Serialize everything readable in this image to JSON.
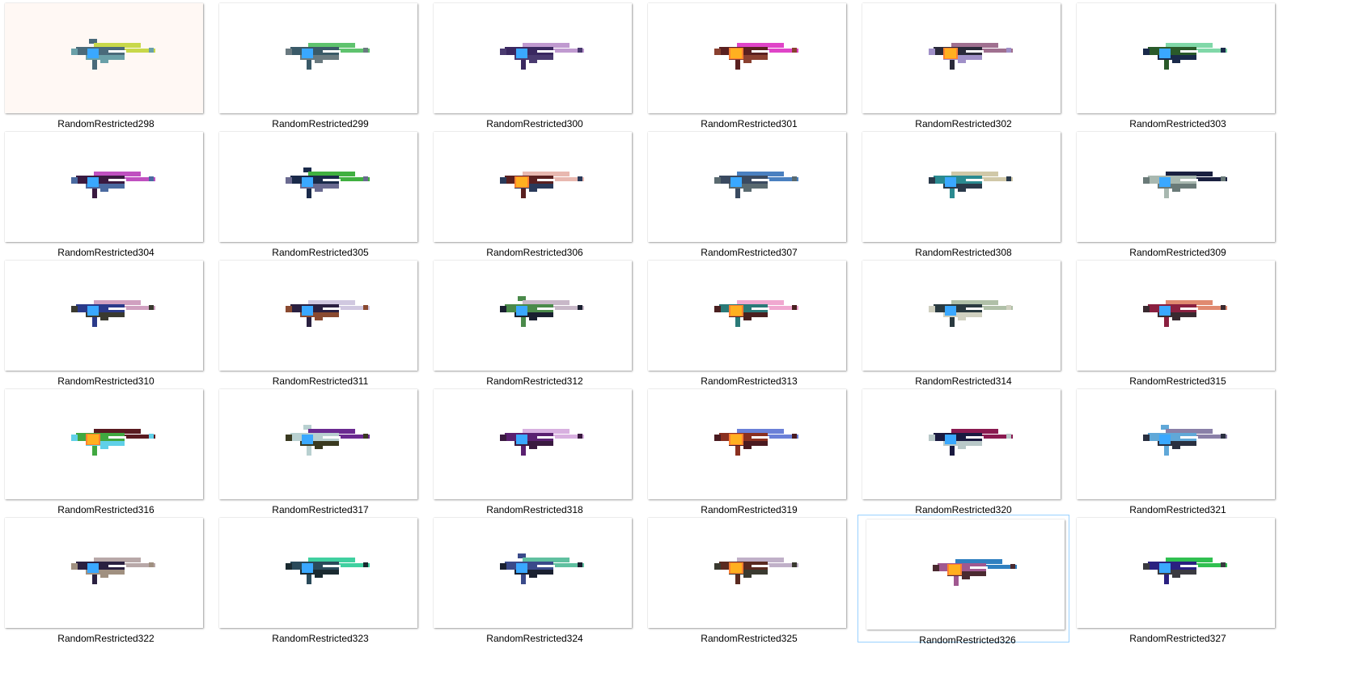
{
  "items": [
    {
      "label": "RandomRestricted298",
      "bg": "#fff8f4",
      "c1": "#c8d84a",
      "c2": "#4a6a7a",
      "c3": "#6aa0a8",
      "core": "#3aa8ff",
      "glow": false,
      "top": true
    },
    {
      "label": "RandomRestricted299",
      "bg": "#ffffff",
      "c1": "#5fc36e",
      "c2": "#3a5a68",
      "c3": "#6a7a80",
      "core": "#3aa8ff",
      "glow": false,
      "top": false
    },
    {
      "label": "RandomRestricted300",
      "bg": "#ffffff",
      "c1": "#c09ad0",
      "c2": "#3a2860",
      "c3": "#4a3a70",
      "core": "#3aa8ff",
      "glow": false,
      "top": false
    },
    {
      "label": "RandomRestricted301",
      "bg": "#ffffff",
      "c1": "#e044c8",
      "c2": "#5a2020",
      "c3": "#8a4030",
      "core": "#ffb020",
      "glow": true,
      "top": false
    },
    {
      "label": "RandomRestricted302",
      "bg": "#ffffff",
      "c1": "#a07090",
      "c2": "#2a2a3a",
      "c3": "#a090c8",
      "core": "#ffb020",
      "glow": true,
      "top": false
    },
    {
      "label": "RandomRestricted303",
      "bg": "#ffffff",
      "c1": "#80d8a8",
      "c2": "#2a5a2a",
      "c3": "#1a2a4a",
      "core": "#3aa8ff",
      "glow": false,
      "top": false
    },
    {
      "label": "RandomRestricted304",
      "bg": "#ffffff",
      "c1": "#c050c0",
      "c2": "#3a1a40",
      "c3": "#4a6aa0",
      "core": "#3aa8ff",
      "glow": false,
      "top": false
    },
    {
      "label": "RandomRestricted305",
      "bg": "#ffffff",
      "c1": "#40b040",
      "c2": "#1a2a4a",
      "c3": "#6a6a90",
      "core": "#3aa8ff",
      "glow": false,
      "top": true
    },
    {
      "label": "RandomRestricted306",
      "bg": "#ffffff",
      "c1": "#e8b8b0",
      "c2": "#5a2020",
      "c3": "#2a3a5a",
      "core": "#ffb020",
      "glow": true,
      "top": false
    },
    {
      "label": "RandomRestricted307",
      "bg": "#ffffff",
      "c1": "#4a80c0",
      "c2": "#3a4a60",
      "c3": "#5a6a70",
      "core": "#3aa8ff",
      "glow": false,
      "top": false
    },
    {
      "label": "RandomRestricted308",
      "bg": "#ffffff",
      "c1": "#d0c8a8",
      "c2": "#2a8a90",
      "c3": "#2a3a4a",
      "core": "#3aa8ff",
      "glow": false,
      "top": false
    },
    {
      "label": "RandomRestricted309",
      "bg": "#ffffff",
      "c1": "#1a2040",
      "c2": "#a8b8b0",
      "c3": "#6a7a78",
      "core": "#3aa8ff",
      "glow": false,
      "top": false
    },
    {
      "label": "RandomRestricted310",
      "bg": "#ffffff",
      "c1": "#d0a0c0",
      "c2": "#2a3a8a",
      "c3": "#3a3a30",
      "core": "#3aa8ff",
      "glow": false,
      "top": false
    },
    {
      "label": "RandomRestricted311",
      "bg": "#ffffff",
      "c1": "#d0c8e0",
      "c2": "#2a2040",
      "c3": "#8a4a30",
      "core": "#3aa8ff",
      "glow": false,
      "top": false
    },
    {
      "label": "RandomRestricted312",
      "bg": "#ffffff",
      "c1": "#c8b8c8",
      "c2": "#4a8a4a",
      "c3": "#1a2030",
      "core": "#3aa8ff",
      "glow": false,
      "top": true
    },
    {
      "label": "RandomRestricted313",
      "bg": "#ffffff",
      "c1": "#f0a8d0",
      "c2": "#2a7a78",
      "c3": "#4a2020",
      "core": "#ffb020",
      "glow": true,
      "top": false
    },
    {
      "label": "RandomRestricted314",
      "bg": "#ffffff",
      "c1": "#b0c0a8",
      "c2": "#2a3a40",
      "c3": "#d0d0c0",
      "core": "#3aa8ff",
      "glow": false,
      "top": false
    },
    {
      "label": "RandomRestricted315",
      "bg": "#ffffff",
      "c1": "#e08a70",
      "c2": "#8a2040",
      "c3": "#3a2a30",
      "core": "#3aa8ff",
      "glow": false,
      "top": false
    },
    {
      "label": "RandomRestricted316",
      "bg": "#ffffff",
      "c1": "#5a1a20",
      "c2": "#40a840",
      "c3": "#60d0e8",
      "core": "#ffb020",
      "glow": true,
      "top": false
    },
    {
      "label": "RandomRestricted317",
      "bg": "#ffffff",
      "c1": "#6a2a90",
      "c2": "#b8d0d0",
      "c3": "#3a3a20",
      "core": "#3aa8ff",
      "glow": false,
      "top": true
    },
    {
      "label": "RandomRestricted318",
      "bg": "#ffffff",
      "c1": "#d8b0e0",
      "c2": "#5a2070",
      "c3": "#3a1a40",
      "core": "#3aa8ff",
      "glow": false,
      "top": false
    },
    {
      "label": "RandomRestricted319",
      "bg": "#ffffff",
      "c1": "#6a80d8",
      "c2": "#8a3020",
      "c3": "#4a1a20",
      "core": "#ffb020",
      "glow": true,
      "top": false
    },
    {
      "label": "RandomRestricted320",
      "bg": "#ffffff",
      "c1": "#8a1a50",
      "c2": "#1a1a40",
      "c3": "#b8c8c8",
      "core": "#3aa8ff",
      "glow": false,
      "top": false
    },
    {
      "label": "RandomRestricted321",
      "bg": "#ffffff",
      "c1": "#8a80a8",
      "c2": "#60a8d8",
      "c3": "#2a3040",
      "core": "#3aa8ff",
      "glow": false,
      "top": true
    },
    {
      "label": "RandomRestricted322",
      "bg": "#ffffff",
      "c1": "#b8a8a8",
      "c2": "#2a2040",
      "c3": "#a09080",
      "core": "#3aa8ff",
      "glow": false,
      "top": false
    },
    {
      "label": "RandomRestricted323",
      "bg": "#ffffff",
      "c1": "#40d0a0",
      "c2": "#2a4a5a",
      "c3": "#1a2a30",
      "core": "#3aa8ff",
      "glow": false,
      "top": false
    },
    {
      "label": "RandomRestricted324",
      "bg": "#ffffff",
      "c1": "#60c0a0",
      "c2": "#3a4a8a",
      "c3": "#1a2030",
      "core": "#3aa8ff",
      "glow": false,
      "top": true
    },
    {
      "label": "RandomRestricted325",
      "bg": "#ffffff",
      "c1": "#c0b0c8",
      "c2": "#5a2a20",
      "c3": "#3a3a30",
      "core": "#ffb020",
      "glow": true,
      "top": false
    },
    {
      "label": "RandomRestricted326",
      "bg": "#ffffff",
      "c1": "#3080c0",
      "c2": "#a05890",
      "c3": "#4a2a30",
      "core": "#ffb020",
      "glow": true,
      "top": false,
      "selected": true
    },
    {
      "label": "RandomRestricted327",
      "bg": "#ffffff",
      "c1": "#30c050",
      "c2": "#2a2080",
      "c3": "#3a3a40",
      "core": "#3aa8ff",
      "glow": false,
      "top": false
    }
  ]
}
